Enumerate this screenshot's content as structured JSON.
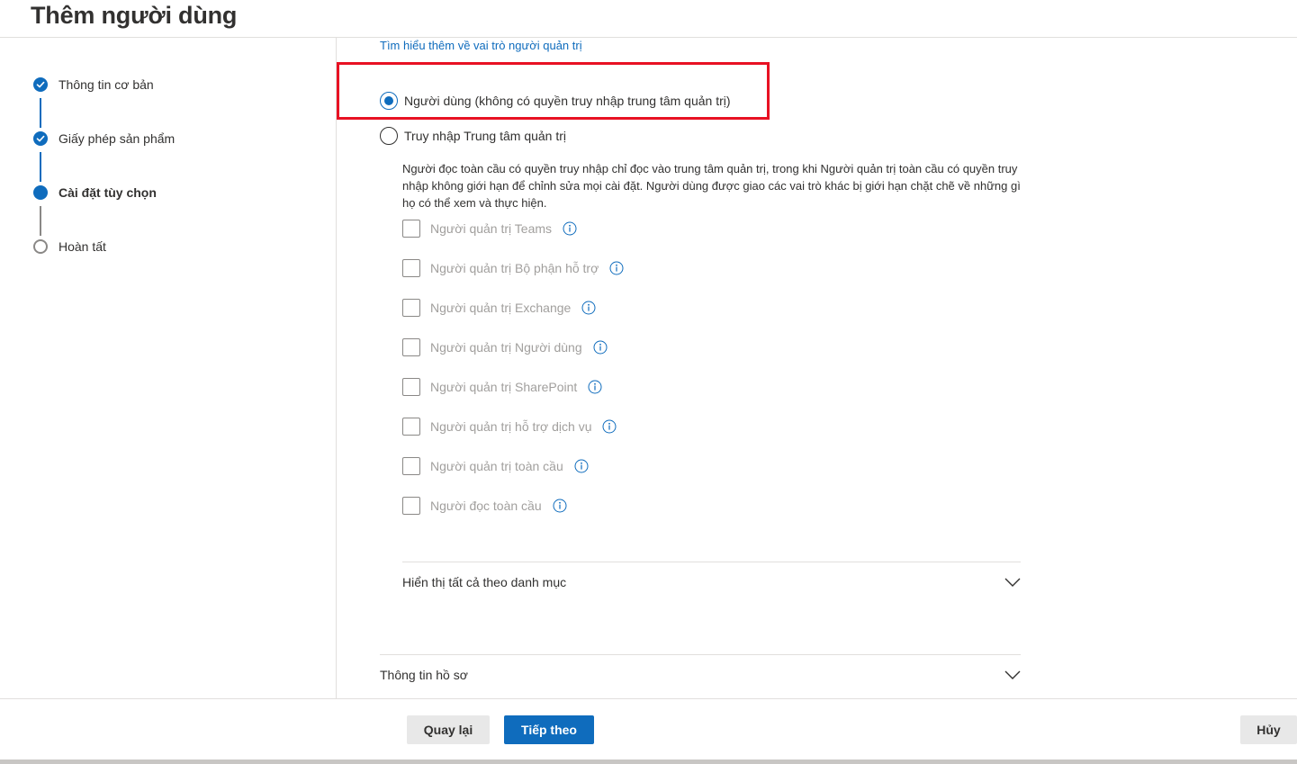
{
  "header": {
    "title": "Thêm người dùng"
  },
  "steps": [
    {
      "label": "Thông tin cơ bản",
      "state": "done"
    },
    {
      "label": "Giấy phép sản phẩm",
      "state": "done"
    },
    {
      "label": "Cài đặt tùy chọn",
      "state": "current"
    },
    {
      "label": "Hoàn tất",
      "state": "todo"
    }
  ],
  "roles": {
    "learn_more_link": "Tìm hiểu thêm về vai trò người quản trị",
    "option_user": "Người dùng (không có quyền truy nhập trung tâm quản trị)",
    "option_admin": "Truy nhập Trung tâm quản trị",
    "selected": "option_user",
    "description": "Người đọc toàn cầu có quyền truy nhập chỉ đọc vào trung tâm quản trị, trong khi Người quản trị toàn cầu có quyền truy nhập không giới hạn để chỉnh sửa mọi cài đặt. Người dùng được giao các vai trò khác bị giới hạn chặt chẽ về những gì họ có thể xem và thực hiện.",
    "admin_roles": [
      "Người quản trị Teams",
      "Người quản trị Bộ phận hỗ trợ",
      "Người quản trị Exchange",
      "Người quản trị Người dùng",
      "Người quản trị SharePoint",
      "Người quản trị hỗ trợ dịch vụ",
      "Người quản trị toàn cầu",
      "Người đọc toàn cầu"
    ],
    "show_all_by_category": "Hiển thị tất cả theo danh mục"
  },
  "profile_info": {
    "label": "Thông tin hồ sơ"
  },
  "footer": {
    "back_label": "Quay lại",
    "next_label": "Tiếp theo",
    "cancel_label": "Hủy"
  },
  "colors": {
    "accent": "#0f6cbd",
    "highlight": "#e81123",
    "disabled_text": "#a19f9d"
  }
}
